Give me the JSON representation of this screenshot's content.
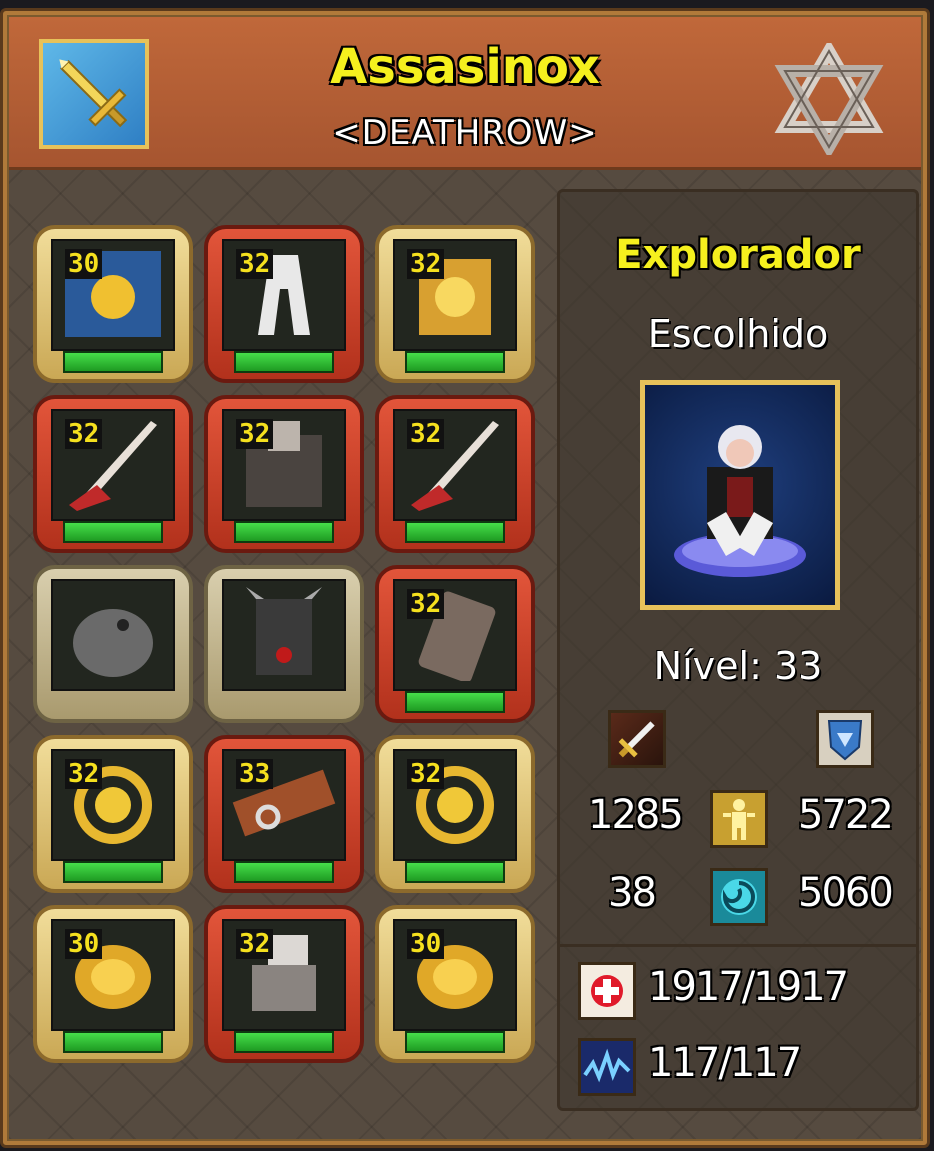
{
  "character": {
    "name": "Assasinox",
    "guild": "<DEATHROW>",
    "class_name": "Explorador",
    "subclass": "Escolhido",
    "level_text": "Nível: 33"
  },
  "stats": {
    "attack_label_icon": "sword-icon",
    "defense_label_icon": "shield-icon",
    "attack": "1285",
    "vitality": "5722",
    "secondary": "38",
    "energy": "5060",
    "hp": "1917/1917",
    "mp": "117/117"
  },
  "equipment": [
    {
      "level": "30",
      "frame": "gold",
      "item": "blue-cape-icon"
    },
    {
      "level": "32",
      "frame": "red",
      "item": "white-helmet-icon"
    },
    {
      "level": "32",
      "frame": "gold",
      "item": "gold-armor-icon"
    },
    {
      "level": "32",
      "frame": "red",
      "item": "dagger-icon"
    },
    {
      "level": "32",
      "frame": "red",
      "item": "dark-armor-icon"
    },
    {
      "level": "32",
      "frame": "red",
      "item": "dagger-icon"
    },
    {
      "level": "",
      "frame": "grey",
      "item": "eagle-pet-icon"
    },
    {
      "level": "",
      "frame": "grey",
      "item": "demon-costume-icon"
    },
    {
      "level": "32",
      "frame": "red",
      "item": "bracer-icon"
    },
    {
      "level": "32",
      "frame": "gold",
      "item": "gold-necklace-icon"
    },
    {
      "level": "33",
      "frame": "red",
      "item": "belt-icon"
    },
    {
      "level": "32",
      "frame": "gold",
      "item": "gold-necklace-icon"
    },
    {
      "level": "30",
      "frame": "gold",
      "item": "gold-ring-icon"
    },
    {
      "level": "32",
      "frame": "red",
      "item": "boots-icon"
    },
    {
      "level": "30",
      "frame": "gold",
      "item": "gold-ring-icon"
    }
  ],
  "colors": {
    "title": "#f5f01e",
    "durability_bar": "#2ec033",
    "header": "#b55d34"
  }
}
